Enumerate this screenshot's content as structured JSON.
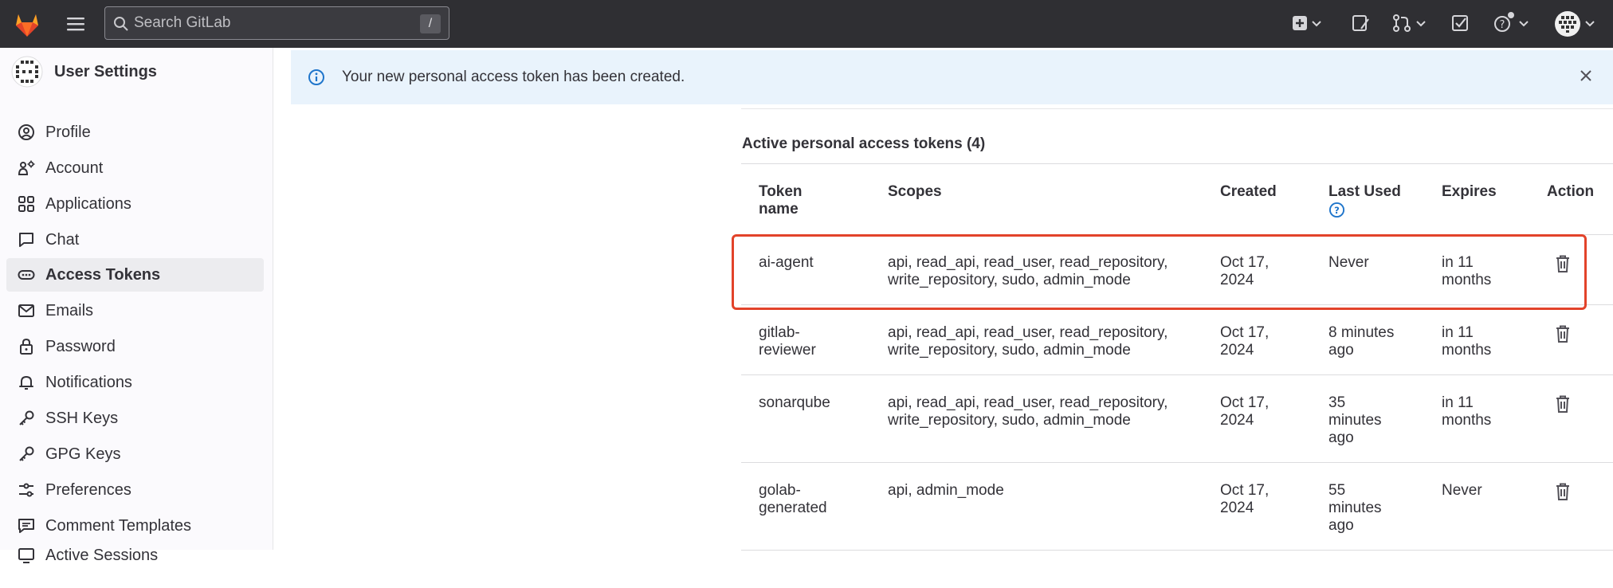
{
  "topbar": {
    "search_placeholder": "Search GitLab",
    "search_shortcut": "/"
  },
  "sidebar": {
    "title": "User Settings",
    "items": [
      {
        "label": "Profile",
        "icon": "profile-icon"
      },
      {
        "label": "Account",
        "icon": "account-icon"
      },
      {
        "label": "Applications",
        "icon": "applications-icon"
      },
      {
        "label": "Chat",
        "icon": "chat-icon"
      },
      {
        "label": "Access Tokens",
        "icon": "token-icon",
        "active": true
      },
      {
        "label": "Emails",
        "icon": "mail-icon"
      },
      {
        "label": "Password",
        "icon": "lock-icon"
      },
      {
        "label": "Notifications",
        "icon": "bell-icon"
      },
      {
        "label": "SSH Keys",
        "icon": "key-icon"
      },
      {
        "label": "GPG Keys",
        "icon": "key-icon"
      },
      {
        "label": "Preferences",
        "icon": "preferences-icon"
      },
      {
        "label": "Comment Templates",
        "icon": "comment-icon"
      },
      {
        "label": "Active Sessions",
        "icon": "monitor-icon"
      }
    ]
  },
  "alert": {
    "message": "Your new personal access token has been created."
  },
  "tokens": {
    "section_title": "Active personal access tokens (4)",
    "headers": {
      "name_line1": "Token",
      "name_line2": "name",
      "scopes": "Scopes",
      "created": "Created",
      "last_used": "Last Used",
      "expires": "Expires",
      "action": "Action"
    },
    "rows": [
      {
        "name1": "ai-agent",
        "name2": "",
        "scopes1": "api, read_api, read_user, read_repository,",
        "scopes2": "write_repository, sudo, admin_mode",
        "created1": "Oct 17,",
        "created2": "2024",
        "used1": "Never",
        "used2": "",
        "used3": "",
        "exp1": "in 11",
        "exp2": "months"
      },
      {
        "name1": "gitlab-",
        "name2": "reviewer",
        "scopes1": "api, read_api, read_user, read_repository,",
        "scopes2": "write_repository, sudo, admin_mode",
        "created1": "Oct 17,",
        "created2": "2024",
        "used1": "8 minutes",
        "used2": "ago",
        "used3": "",
        "exp1": "in 11",
        "exp2": "months"
      },
      {
        "name1": "sonarqube",
        "name2": "",
        "scopes1": "api, read_api, read_user, read_repository,",
        "scopes2": "write_repository, sudo, admin_mode",
        "created1": "Oct 17,",
        "created2": "2024",
        "used1": "35",
        "used2": "minutes",
        "used3": "ago",
        "exp1": "in 11",
        "exp2": "months"
      },
      {
        "name1": "golab-",
        "name2": "generated",
        "scopes1": "api, admin_mode",
        "scopes2": "",
        "created1": "Oct 17,",
        "created2": "2024",
        "used1": "55",
        "used2": "minutes",
        "used3": "ago",
        "exp1": "Never",
        "exp2": ""
      }
    ]
  },
  "colors": {
    "topbar_bg": "#2f2f33",
    "alert_bg": "#e9f3fc",
    "info_blue": "#1f75cb",
    "highlight_red": "#e2432a"
  }
}
